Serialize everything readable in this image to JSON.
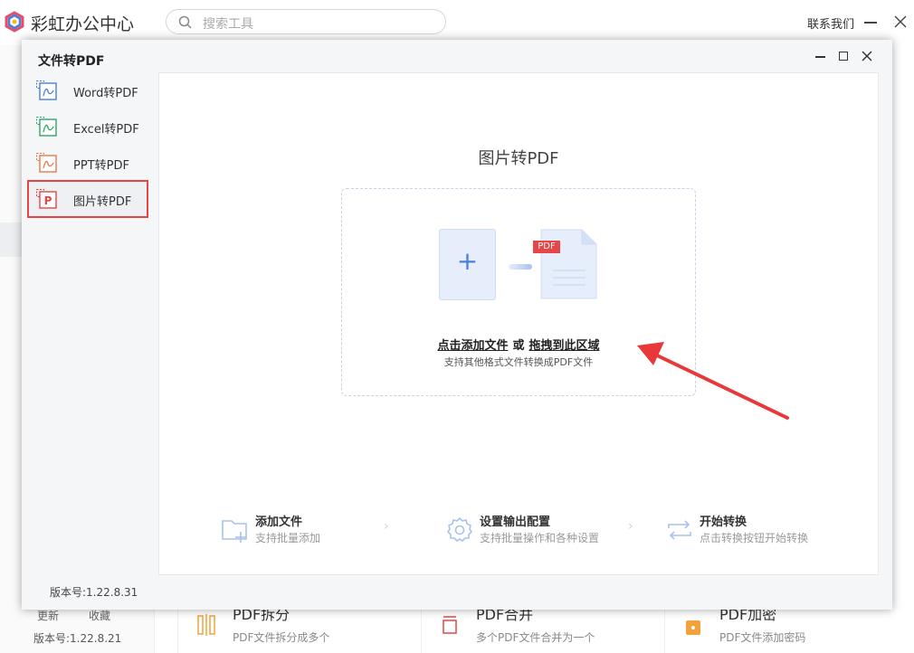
{
  "app": {
    "title": "彩虹办公中心",
    "contact_label": "联系我们"
  },
  "search": {
    "placeholder": "搜索工具"
  },
  "background": {
    "links": [
      "更新",
      "收藏"
    ],
    "version": "版本号:1.22.8.21",
    "cards": [
      {
        "title": "PDF拆分",
        "subtitle": "PDF文件拆分成多个"
      },
      {
        "title": "PDF合并",
        "subtitle": "多个PDF文件合并为一个"
      },
      {
        "title": "PDF加密",
        "subtitle": "PDF文件添加密码"
      }
    ]
  },
  "dialog": {
    "title": "文件转PDF",
    "nav": [
      {
        "label": "Word转PDF",
        "color": "#4a7fd8"
      },
      {
        "label": "Excel转PDF",
        "color": "#2ea66a"
      },
      {
        "label": "PPT转PDF",
        "color": "#e8794a"
      },
      {
        "label": "图片转PDF",
        "color": "#e64646",
        "active": true
      }
    ],
    "version": "版本号:1.22.8.31",
    "panel_title": "图片转PDF",
    "drop": {
      "badge": "PDF",
      "add_link": "点击添加文件",
      "or": "或",
      "drag_text": "拖拽到此区域",
      "hint": "支持其他格式文件转换成PDF文件"
    },
    "steps": [
      {
        "title": "添加文件",
        "subtitle": "支持批量添加"
      },
      {
        "title": "设置输出配置",
        "subtitle": "支持批量操作和各种设置"
      },
      {
        "title": "开始转换",
        "subtitle": "点击转换按钮开始转换"
      }
    ],
    "step_separator": "›"
  },
  "colors": {
    "accent": "#4a7fd8",
    "danger": "#e64646",
    "arrow": "#e8383a"
  }
}
